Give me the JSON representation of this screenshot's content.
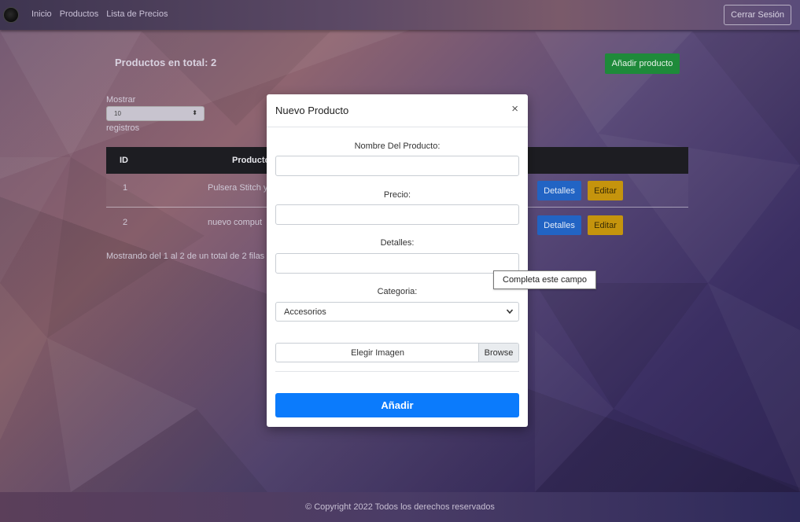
{
  "navbar": {
    "links": [
      "Inicio",
      "Productos",
      "Lista de Precios"
    ],
    "logout_label": "Cerrar Sesión"
  },
  "page": {
    "total_title": "Productos en total: 2",
    "add_product_label": "Añadir producto",
    "show_label": "Mostrar",
    "entries_value": "10",
    "records_label": "registros",
    "table": {
      "headers": [
        "ID",
        "Producto"
      ],
      "rows": [
        {
          "id": "1",
          "product": "Pulsera Stitch y",
          "details_label": "Detalles",
          "edit_label": "Editar"
        },
        {
          "id": "2",
          "product": "nuevo comput",
          "details_label": "Detalles",
          "edit_label": "Editar"
        }
      ]
    },
    "table_info": "Mostrando del 1 al 2 de un total de 2 filas"
  },
  "modal": {
    "title": "Nuevo Producto",
    "close_symbol": "×",
    "fields": {
      "name_label": "Nombre Del Producto:",
      "price_label": "Precio:",
      "details_label": "Detalles:",
      "category_label": "Categoria:",
      "category_value": "Accesorios",
      "file_label": "Elegir Imagen",
      "browse_label": "Browse"
    },
    "submit_label": "Añadir"
  },
  "tooltip": {
    "text": "Completa este campo"
  },
  "footer": {
    "text": "© Copyright 2022 Todos los derechos reservados"
  },
  "colors": {
    "primary": "#0b7bfc",
    "success": "#1e8a3a",
    "info": "#2264c4",
    "warning": "#c5940d",
    "table_header": "#1d1d22"
  }
}
